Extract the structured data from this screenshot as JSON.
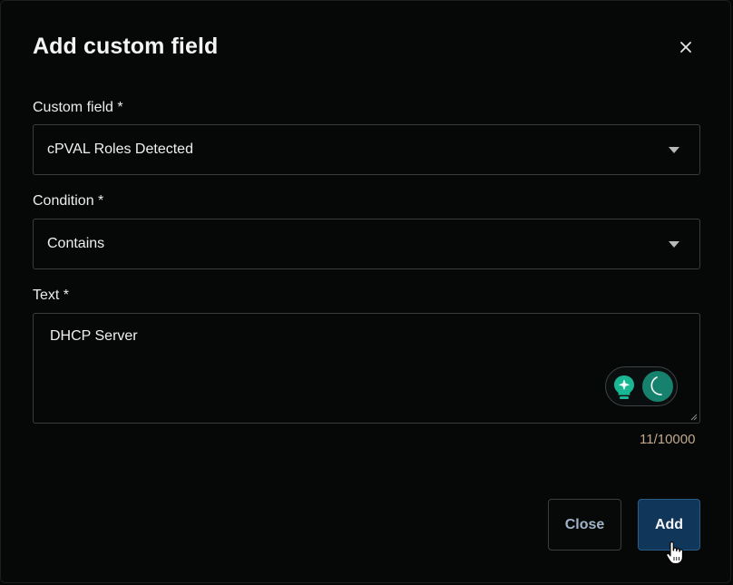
{
  "dialog": {
    "title": "Add custom field",
    "close_icon": "close-icon"
  },
  "custom_field": {
    "label": "Custom field *",
    "value": "cPVAL Roles Detected",
    "icon": "caret-down-icon"
  },
  "condition": {
    "label": "Condition *",
    "value": "Contains",
    "icon": "caret-down-icon"
  },
  "text": {
    "label": "Text *",
    "value": "DHCP Server",
    "char_count": "11/10000",
    "assist_icons": [
      "lightbulb-sparkle-icon",
      "loading-spinner-icon"
    ]
  },
  "buttons": {
    "close_label": "Close",
    "add_label": "Add"
  },
  "colors": {
    "accent": "#10365a",
    "assist_teal": "#16816c",
    "counter": "#c0a98d"
  }
}
